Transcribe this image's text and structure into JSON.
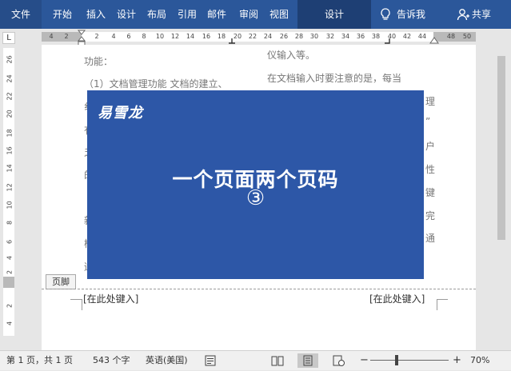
{
  "ribbon": {
    "tabs": [
      "文件",
      "开始",
      "插入",
      "设计",
      "布局",
      "引用",
      "邮件",
      "审阅",
      "视图",
      "设计"
    ],
    "tell_me": "告诉我",
    "share": "共享"
  },
  "ruler": {
    "corner": "L",
    "h_numbers": [
      "4",
      "2",
      "2",
      "4",
      "6",
      "8",
      "10",
      "12",
      "14",
      "16",
      "18",
      "20",
      "22",
      "24",
      "26",
      "28",
      "30",
      "32",
      "34",
      "36",
      "38",
      "40",
      "42",
      "44",
      "48",
      "50"
    ],
    "v_numbers": [
      "26",
      "24",
      "22",
      "20",
      "18",
      "16",
      "14",
      "12",
      "10",
      "8",
      "6",
      "4",
      "2",
      "2",
      "4"
    ]
  },
  "document": {
    "left_col": [
      "功能：",
      "（1）文档管理功能   文档的建立、",
      "纟",
      "有",
      "乏",
      "的",
      "新",
      "检",
      "适"
    ],
    "right_col": [
      "仪输入等。",
      "在文档输入时要注意的是，每当",
      "理",
      "”",
      "户",
      "性",
      "键",
      "完",
      "通"
    ],
    "footer_tag": "页脚",
    "placeholder_left": "[在此处键入]",
    "placeholder_right": "[在此处键入]"
  },
  "overlay": {
    "logo": "易雪龙",
    "title": "一个页面两个页码",
    "number": "③"
  },
  "status": {
    "page": "第 1 页，共 1 页",
    "words": "543 个字",
    "lang": "英语(美国)",
    "zoom_minus": "−",
    "zoom_plus": "+",
    "zoom": "70%"
  }
}
